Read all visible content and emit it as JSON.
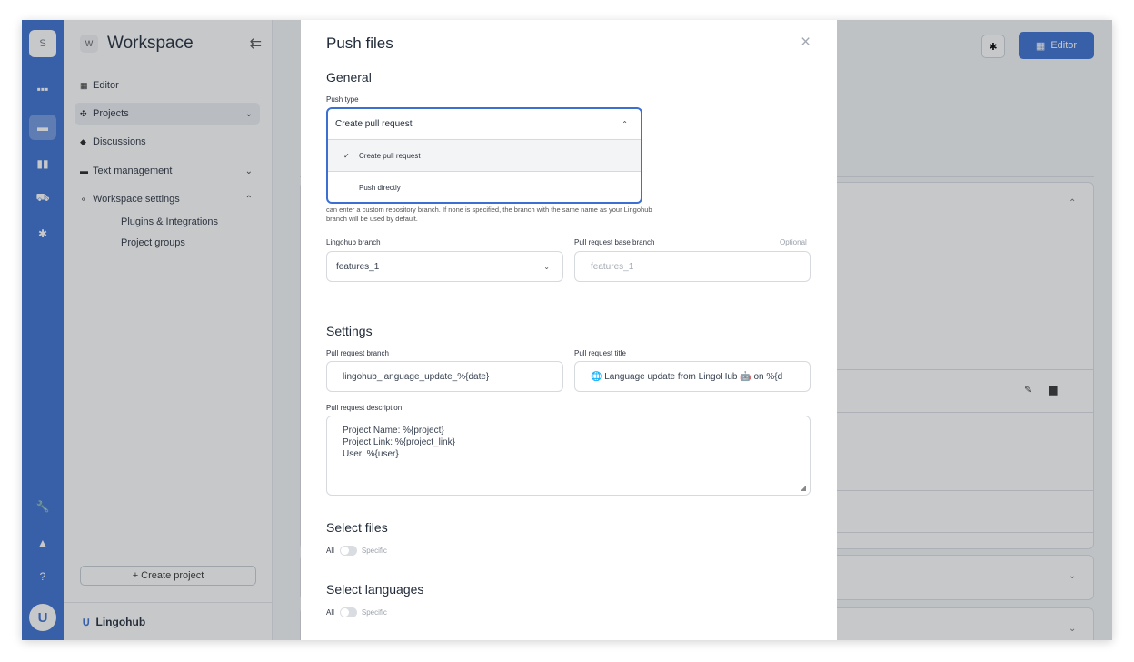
{
  "rail": {
    "avatar_letter": "S",
    "logo_letter": "U"
  },
  "sidebar": {
    "workspace_badge": "W",
    "workspace_title": "Workspace",
    "collapse_icon": "⇇",
    "items": [
      {
        "label": "Editor",
        "icon": "▦"
      },
      {
        "label": "Projects",
        "icon": "✣"
      },
      {
        "label": "Discussions",
        "icon": "◆"
      },
      {
        "label": "Text management",
        "icon": "▬"
      },
      {
        "label": "Workspace settings",
        "icon": "⚬"
      }
    ],
    "subitems": [
      "Plugins & Integrations",
      "Project groups"
    ],
    "create_project_label": "+ Create project",
    "footer_brand": "Lingohub"
  },
  "header": {
    "editor_button_label": "Editor"
  },
  "modal": {
    "title": "Push files",
    "close_icon": "×",
    "general_title": "General",
    "push_type_label": "Push type",
    "push_type_value": "Create pull request",
    "push_type_options": [
      "Create pull request",
      "Push directly"
    ],
    "help_text": "can enter a custom repository branch. If none is specified, the branch with the same name as your Lingohub branch will be used by default.",
    "lingohub_branch_label": "Lingohub branch",
    "lingohub_branch_value": "features_1",
    "base_branch_label": "Pull request base branch",
    "base_branch_optional": "Optional",
    "base_branch_placeholder": "features_1",
    "settings_title": "Settings",
    "pr_branch_label": "Pull request branch",
    "pr_branch_value": "lingohub_language_update_%{date}",
    "pr_title_label": "Pull request title",
    "pr_title_value": "🌐 Language update from LingoHub 🤖 on %{d",
    "pr_desc_label": "Pull request description",
    "pr_desc_lines": [
      "Project Name: %{project}",
      "Project Link: %{project_link}",
      "User: %{user}"
    ],
    "select_files_title": "Select files",
    "select_languages_title": "Select languages",
    "toggle_all": "All",
    "toggle_specific": "Specific"
  },
  "colors": {
    "brand": "#3b6fd1",
    "overlay": "rgba(52,56,64,0.28)"
  }
}
